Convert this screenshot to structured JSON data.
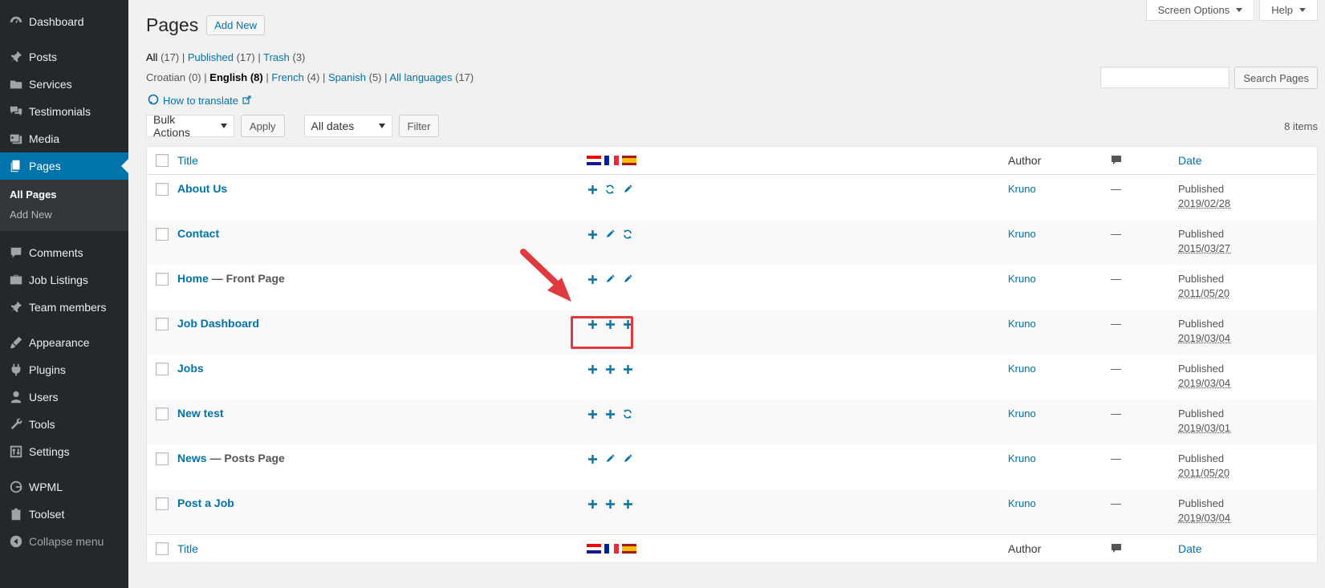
{
  "sidebar": {
    "items": [
      {
        "label": "Dashboard",
        "icon": "dashboard-icon"
      },
      {
        "label": "Posts",
        "icon": "pin-icon"
      },
      {
        "label": "Services",
        "icon": "folder-icon"
      },
      {
        "label": "Testimonials",
        "icon": "comments-icon"
      },
      {
        "label": "Media",
        "icon": "media-icon"
      },
      {
        "label": "Pages",
        "icon": "pages-icon"
      },
      {
        "label": "Comments",
        "icon": "comment-icon"
      },
      {
        "label": "Job Listings",
        "icon": "briefcase-icon"
      },
      {
        "label": "Team members",
        "icon": "pin-icon"
      },
      {
        "label": "Appearance",
        "icon": "brush-icon"
      },
      {
        "label": "Plugins",
        "icon": "plug-icon"
      },
      {
        "label": "Users",
        "icon": "user-icon"
      },
      {
        "label": "Tools",
        "icon": "wrench-icon"
      },
      {
        "label": "Settings",
        "icon": "settings-icon"
      },
      {
        "label": "WPML",
        "icon": "wpml-icon"
      },
      {
        "label": "Toolset",
        "icon": "toolset-icon"
      }
    ],
    "submenu": [
      "All Pages",
      "Add New"
    ],
    "collapse": "Collapse menu"
  },
  "header": {
    "screen_options": "Screen Options",
    "help": "Help",
    "title": "Pages",
    "add_new": "Add New"
  },
  "filters": {
    "all": "All",
    "all_count": "(17)",
    "published": "Published",
    "published_count": "(17)",
    "trash": "Trash",
    "trash_count": "(3)",
    "sep": "|"
  },
  "languages": {
    "croatian": "Croatian (0)",
    "english": "English (8)",
    "french": "French",
    "french_count": "(4)",
    "spanish": "Spanish",
    "spanish_count": "(5)",
    "all_languages": "All languages",
    "all_languages_count": "(17)"
  },
  "how_to_translate": "How to translate",
  "search": {
    "button": "Search Pages"
  },
  "tablenav": {
    "bulk_actions": "Bulk Actions",
    "apply": "Apply",
    "all_dates": "All dates",
    "filter": "Filter",
    "items": "8 items"
  },
  "table": {
    "columns": {
      "title": "Title",
      "author": "Author",
      "date": "Date"
    },
    "rows": [
      {
        "title": "About Us",
        "state": "",
        "icons": [
          "plus",
          "sync",
          "pencil"
        ],
        "author": "Kruno",
        "comments": "—",
        "status": "Published",
        "date": "2019/02/28"
      },
      {
        "title": "Contact",
        "state": "",
        "icons": [
          "plus",
          "pencil",
          "sync"
        ],
        "author": "Kruno",
        "comments": "—",
        "status": "Published",
        "date": "2015/03/27"
      },
      {
        "title": "Home",
        "state": " — Front Page",
        "icons": [
          "plus",
          "pencil",
          "pencil"
        ],
        "author": "Kruno",
        "comments": "—",
        "status": "Published",
        "date": "2011/05/20"
      },
      {
        "title": "Job Dashboard",
        "state": "",
        "icons": [
          "plus",
          "plus",
          "plus"
        ],
        "author": "Kruno",
        "comments": "—",
        "status": "Published",
        "date": "2019/03/04"
      },
      {
        "title": "Jobs",
        "state": "",
        "icons": [
          "plus",
          "plus",
          "plus"
        ],
        "author": "Kruno",
        "comments": "—",
        "status": "Published",
        "date": "2019/03/04"
      },
      {
        "title": "New test",
        "state": "",
        "icons": [
          "plus",
          "plus",
          "sync"
        ],
        "author": "Kruno",
        "comments": "—",
        "status": "Published",
        "date": "2019/03/01"
      },
      {
        "title": "News",
        "state": " — Posts Page",
        "icons": [
          "plus",
          "pencil",
          "pencil"
        ],
        "author": "Kruno",
        "comments": "—",
        "status": "Published",
        "date": "2011/05/20"
      },
      {
        "title": "Post a Job",
        "state": "",
        "icons": [
          "plus",
          "plus",
          "plus"
        ],
        "author": "Kruno",
        "comments": "—",
        "status": "Published",
        "date": "2019/03/04"
      }
    ]
  },
  "colors": {
    "accent": "#0073aa",
    "sidebar": "#23282d",
    "annotation": "#e0393e"
  }
}
